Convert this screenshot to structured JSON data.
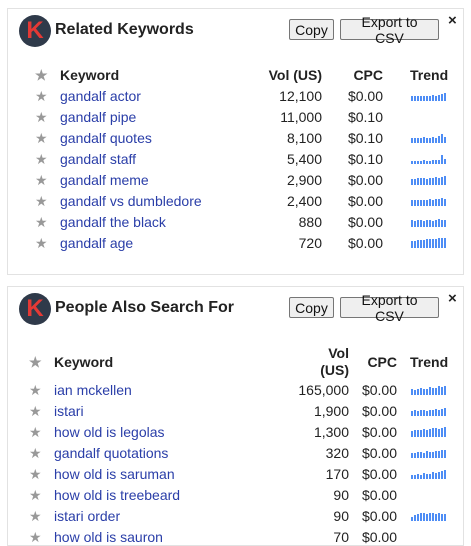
{
  "copy_label": "Copy",
  "export_label": "Export to CSV",
  "close_glyph": "×",
  "logo_letter": "K",
  "star_glyph": "★",
  "accent_color": "#4e8df5",
  "related": {
    "title": "Related Keywords",
    "headers": {
      "keyword": "Keyword",
      "vol": "Vol (US)",
      "cpc": "CPC",
      "trend": "Trend"
    },
    "rows": [
      {
        "keyword": "gandalf actor",
        "vol": "12,100",
        "cpc": "$0.00",
        "trend": [
          0.5,
          0.5,
          0.5,
          0.5,
          0.5,
          0.5,
          0.5,
          0.6,
          0.5,
          0.6,
          0.7,
          0.8
        ]
      },
      {
        "keyword": "gandalf pipe",
        "vol": "11,000",
        "cpc": "$0.10",
        "trend": null
      },
      {
        "keyword": "gandalf quotes",
        "vol": "8,100",
        "cpc": "$0.10",
        "trend": [
          0.5,
          0.5,
          0.5,
          0.5,
          0.6,
          0.5,
          0.5,
          0.6,
          0.5,
          0.7,
          0.9,
          0.6
        ]
      },
      {
        "keyword": "gandalf staff",
        "vol": "5,400",
        "cpc": "$0.10",
        "trend": [
          0.3,
          0.3,
          0.3,
          0.3,
          0.4,
          0.3,
          0.3,
          0.4,
          0.4,
          0.4,
          0.9,
          0.5
        ]
      },
      {
        "keyword": "gandalf meme",
        "vol": "2,900",
        "cpc": "$0.00",
        "trend": [
          0.6,
          0.6,
          0.7,
          0.7,
          0.7,
          0.6,
          0.7,
          0.7,
          0.8,
          0.7,
          0.8,
          0.9
        ]
      },
      {
        "keyword": "gandalf vs dumbledore",
        "vol": "2,400",
        "cpc": "$0.00",
        "trend": [
          0.6,
          0.6,
          0.6,
          0.6,
          0.6,
          0.6,
          0.7,
          0.6,
          0.7,
          0.7,
          0.8,
          0.7
        ]
      },
      {
        "keyword": "gandalf the black",
        "vol": "880",
        "cpc": "$0.00",
        "trend": [
          0.7,
          0.6,
          0.7,
          0.7,
          0.6,
          0.7,
          0.7,
          0.6,
          0.7,
          0.8,
          0.7,
          0.7
        ]
      },
      {
        "keyword": "gandalf age",
        "vol": "720",
        "cpc": "$0.00",
        "trend": [
          0.7,
          0.7,
          0.8,
          0.8,
          0.8,
          0.9,
          0.9,
          0.9,
          0.9,
          1.0,
          1.0,
          1.0
        ]
      }
    ]
  },
  "people": {
    "title": "People Also Search For",
    "headers": {
      "keyword": "Keyword",
      "vol_line1": "Vol",
      "vol_line2": "(US)",
      "cpc": "CPC",
      "trend": "Trend"
    },
    "rows": [
      {
        "keyword": "ian mckellen",
        "vol": "165,000",
        "cpc": "$0.00",
        "trend": [
          0.6,
          0.5,
          0.6,
          0.7,
          0.6,
          0.6,
          0.8,
          0.7,
          0.7,
          0.9,
          0.8,
          0.9
        ]
      },
      {
        "keyword": "istari",
        "vol": "1,900",
        "cpc": "$0.00",
        "trend": [
          0.5,
          0.6,
          0.5,
          0.6,
          0.6,
          0.5,
          0.6,
          0.6,
          0.7,
          0.6,
          0.7,
          0.8
        ]
      },
      {
        "keyword": "how old is legolas",
        "vol": "1,300",
        "cpc": "$0.00",
        "trend": [
          0.6,
          0.7,
          0.7,
          0.7,
          0.8,
          0.7,
          0.8,
          0.9,
          0.9,
          0.8,
          0.9,
          1.0
        ]
      },
      {
        "keyword": "gandalf quotations",
        "vol": "320",
        "cpc": "$0.00",
        "trend": [
          0.5,
          0.5,
          0.6,
          0.6,
          0.5,
          0.7,
          0.6,
          0.6,
          0.7,
          0.7,
          0.8,
          0.8
        ]
      },
      {
        "keyword": "how old is saruman",
        "vol": "170",
        "cpc": "$0.00",
        "trend": [
          0.4,
          0.4,
          0.5,
          0.4,
          0.6,
          0.5,
          0.5,
          0.7,
          0.6,
          0.7,
          0.8,
          0.9
        ]
      },
      {
        "keyword": "how old is treebeard",
        "vol": "90",
        "cpc": "$0.00",
        "trend": null
      },
      {
        "keyword": "istari order",
        "vol": "90",
        "cpc": "$0.00",
        "trend": [
          0.4,
          0.6,
          0.7,
          0.8,
          0.8,
          0.7,
          0.8,
          0.8,
          0.7,
          0.8,
          0.7,
          0.7
        ]
      },
      {
        "keyword": "how old is sauron",
        "vol": "70",
        "cpc": "$0.00",
        "trend": null
      }
    ]
  }
}
